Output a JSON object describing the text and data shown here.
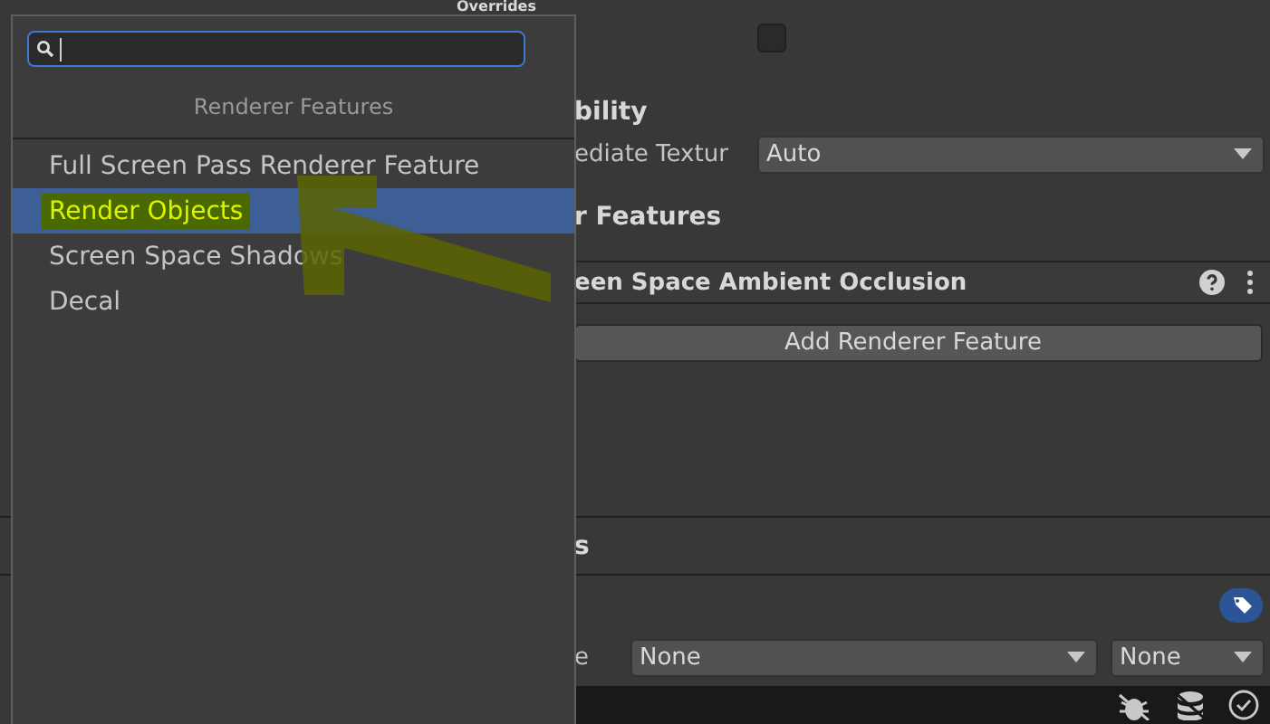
{
  "inspector": {
    "section_title": "Overrides",
    "checkbox": {
      "checked": false
    },
    "compatibility_heading": "bility",
    "texture_row": {
      "label": "ediate Textur",
      "value": "Auto"
    },
    "features_heading": "r Features",
    "feature": {
      "title": "een Space Ambient Occlusion"
    },
    "add_button": "Add Renderer Feature",
    "lower_section_title": "s",
    "layer_row": {
      "label": "e",
      "values": [
        "None",
        "None"
      ]
    }
  },
  "popup": {
    "title": "Renderer Features",
    "items": [
      {
        "label": "Full Screen Pass Renderer Feature",
        "selected": false,
        "highlighted": false
      },
      {
        "label": "Render Objects",
        "selected": true,
        "highlighted": true
      },
      {
        "label": "Screen Space Shadows",
        "selected": false,
        "highlighted": false
      },
      {
        "label": "Decal",
        "selected": false,
        "highlighted": false
      }
    ]
  }
}
